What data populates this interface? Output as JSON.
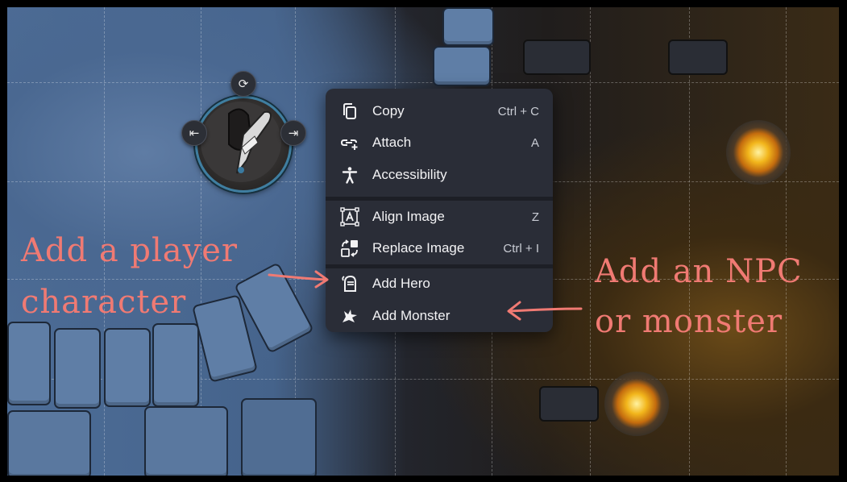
{
  "menu": {
    "items": [
      {
        "label": "Copy",
        "shortcut": "Ctrl + C",
        "icon": "copy-icon"
      },
      {
        "label": "Attach",
        "shortcut": "A",
        "icon": "link-icon"
      },
      {
        "label": "Accessibility",
        "shortcut": "",
        "icon": "accessibility-icon"
      },
      {
        "label": "Align Image",
        "shortcut": "Z",
        "icon": "align-image-icon"
      },
      {
        "label": "Replace Image",
        "shortcut": "Ctrl + I",
        "icon": "replace-image-icon"
      },
      {
        "label": "Add Hero",
        "shortcut": "",
        "icon": "knight-helmet-icon"
      },
      {
        "label": "Add Monster",
        "shortcut": "",
        "icon": "dragon-head-icon"
      }
    ]
  },
  "annotations": {
    "left_line1": "Add a player",
    "left_line2": "character",
    "right_line1": "Add an NPC",
    "right_line2": "or monster"
  },
  "colors": {
    "annotation": "#f07a73",
    "menu_bg": "#2a2d37",
    "token_ring": "#3f7ea0"
  }
}
